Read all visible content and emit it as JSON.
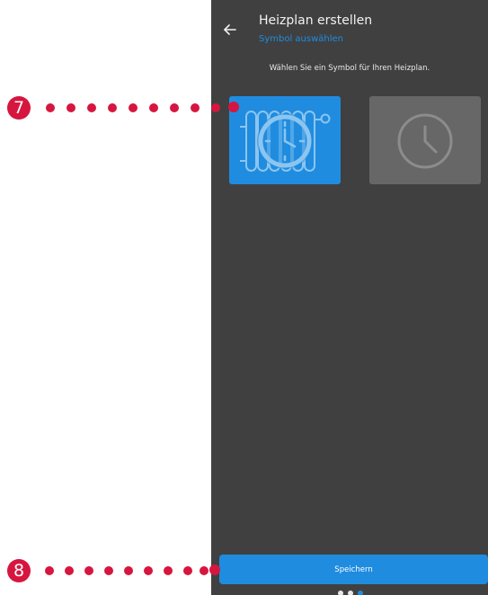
{
  "header": {
    "back_icon": "arrow-left-icon",
    "title": "Heizplan erstellen",
    "subtitle": "Symbol auswählen"
  },
  "instruction": "Wählen Sie ein Symbol für Ihren Heizplan.",
  "symbols": [
    {
      "icon": "radiator-clock-icon",
      "selected": true,
      "color": "#1f8ce0"
    },
    {
      "icon": "clock-icon",
      "selected": false,
      "color": "#676767"
    }
  ],
  "save_label": "Speichern",
  "pagination": {
    "total": 3,
    "active_index": 2
  },
  "callouts": [
    {
      "number": "7",
      "target": "radiator-clock-tile"
    },
    {
      "number": "8",
      "target": "save-button"
    }
  ],
  "colors": {
    "accent": "#1f8ce0",
    "background": "#404040",
    "callout": "#d6163f"
  }
}
